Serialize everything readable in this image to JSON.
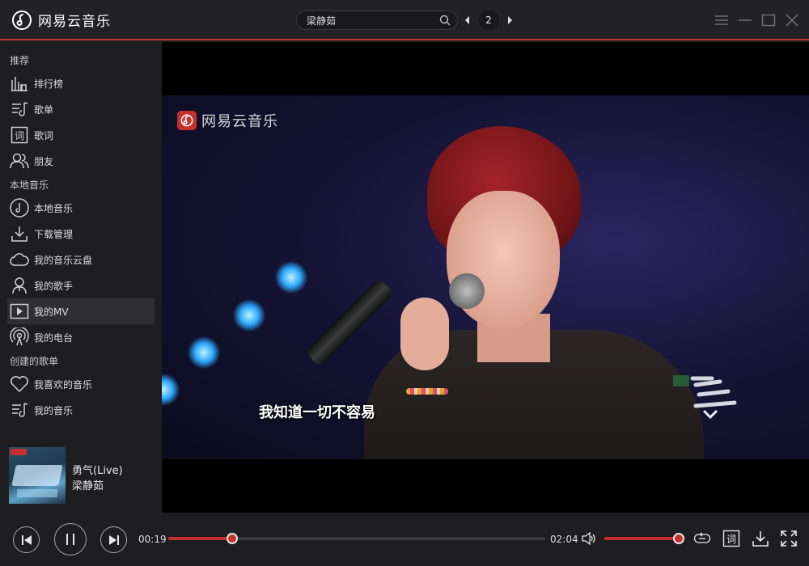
{
  "app": {
    "title": "网易云音乐",
    "accent_color": "#c62f2f"
  },
  "header": {
    "search_value": "梁静茹",
    "page_number": "2",
    "icons": [
      "logo-icon",
      "search-icon",
      "prev-arrow-icon",
      "next-arrow-icon",
      "menu-icon",
      "minimize-icon",
      "maximize-icon",
      "close-icon"
    ]
  },
  "sidebar": {
    "sections": {
      "recommend": "推荐",
      "local": "本地音乐",
      "created": "创建的歌单"
    },
    "items": [
      {
        "label": "排行榜",
        "icon": "chart-bars-icon"
      },
      {
        "label": "歌单",
        "icon": "playlist-icon"
      },
      {
        "label": "歌词",
        "icon": "lyrics-icon"
      },
      {
        "label": "朋友",
        "icon": "friends-icon"
      },
      {
        "label": "本地音乐",
        "icon": "music-note-icon"
      },
      {
        "label": "下载管理",
        "icon": "download-icon"
      },
      {
        "label": "我的音乐云盘",
        "icon": "cloud-icon"
      },
      {
        "label": "我的歌手",
        "icon": "singer-icon"
      },
      {
        "label": "我的MV",
        "icon": "mv-play-icon",
        "active": true
      },
      {
        "label": "我的电台",
        "icon": "radio-icon"
      },
      {
        "label": "我喜欢的音乐",
        "icon": "heart-icon"
      },
      {
        "label": "我的音乐",
        "icon": "playlist-icon"
      }
    ]
  },
  "now_playing": {
    "title": "勇气(Live)",
    "artist": "梁静茹"
  },
  "video": {
    "watermark": "网易云音乐",
    "subtitle": "我知道一切不容易"
  },
  "player": {
    "current_time": "00:19",
    "total_time": "02:04",
    "progress_fraction": 0.17,
    "volume_fraction": 1.0,
    "icons": [
      "prev-track-icon",
      "pause-icon",
      "next-track-icon",
      "volume-icon",
      "loop-icon",
      "lyrics-toggle-icon",
      "download-icon",
      "fullscreen-icon"
    ]
  }
}
